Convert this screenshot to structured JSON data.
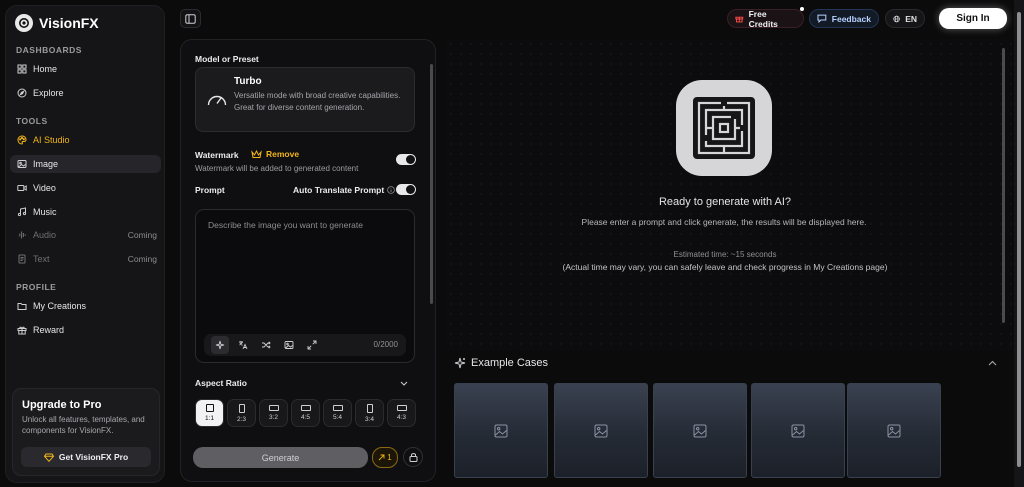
{
  "brand": {
    "name": "VisionFX"
  },
  "sidebar": {
    "sections": [
      {
        "title": "DASHBOARDS",
        "items": [
          {
            "label": "Home",
            "icon": "grid-icon"
          },
          {
            "label": "Explore",
            "icon": "compass-icon"
          }
        ]
      },
      {
        "title": "TOOLS",
        "items": [
          {
            "label": "AI Studio",
            "icon": "palette-icon"
          },
          {
            "label": "Image",
            "icon": "image-icon"
          },
          {
            "label": "Video",
            "icon": "video-icon"
          },
          {
            "label": "Music",
            "icon": "music-icon"
          },
          {
            "label": "Audio",
            "icon": "waveform-icon",
            "tag": "Coming"
          },
          {
            "label": "Text",
            "icon": "document-icon",
            "tag": "Coming"
          }
        ]
      },
      {
        "title": "PROFILE",
        "items": [
          {
            "label": "My Creations",
            "icon": "folder-icon"
          },
          {
            "label": "Reward",
            "icon": "gift-icon"
          }
        ]
      }
    ],
    "upgrade": {
      "title": "Upgrade to Pro",
      "description": "Unlock all features, templates, and components for VisionFX.",
      "button": "Get VisionFX Pro"
    }
  },
  "topbar": {
    "free_credits": "Free Credits",
    "feedback": "Feedback",
    "language": "EN",
    "sign_in": "Sign In"
  },
  "settings": {
    "model_label": "Model or Preset",
    "model": {
      "name": "Turbo",
      "description": "Versatile mode with broad creative capabilities. Great for diverse content generation."
    },
    "watermark_label": "Watermark",
    "watermark_remove": "Remove",
    "watermark_note": "Watermark will be added to generated content",
    "watermark_on": true,
    "prompt_label": "Prompt",
    "auto_translate_label": "Auto Translate Prompt",
    "auto_translate_on": true,
    "prompt_placeholder": "Describe the image you want to generate",
    "char_counter": "0/2000",
    "aspect_label": "Aspect Ratio",
    "aspect_ratios": [
      "1:1",
      "2:3",
      "3:2",
      "4:5",
      "5:4",
      "3:4",
      "4:3"
    ],
    "aspect_selected": "1:1",
    "generate": "Generate",
    "cost": "1"
  },
  "main": {
    "ready_title": "Ready to generate with AI?",
    "ready_sub": "Please enter a prompt and click generate, the results will be displayed here.",
    "estimated": "Estimated time: ~15 seconds",
    "estimated_note": "(Actual time may vary, you can safely leave and check progress in My Creations page)",
    "examples_title": "Example Cases",
    "example_count": 5
  },
  "colors": {
    "accent": "#f1b51a",
    "background": "#0b0b0c",
    "panel": "#151517"
  }
}
